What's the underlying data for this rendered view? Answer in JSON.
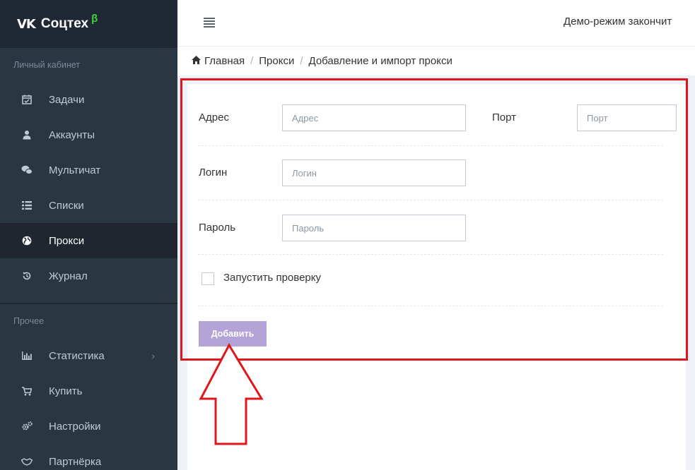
{
  "brand": {
    "logo": "vk-logo",
    "logo_text": "VK",
    "name": "Соцтех",
    "beta": "β"
  },
  "sidebar": {
    "section1_title": "Личный кабинет",
    "items": [
      {
        "label": "Задачи",
        "icon": "calendar-check-icon",
        "glyph": "📅"
      },
      {
        "label": "Аккаунты",
        "icon": "user-icon",
        "glyph": "👤"
      },
      {
        "label": "Мультичат",
        "icon": "chat-icon",
        "glyph": "💬"
      },
      {
        "label": "Списки",
        "icon": "list-icon",
        "glyph": "☰"
      },
      {
        "label": "Прокси",
        "icon": "globe-icon",
        "glyph": "🌍",
        "active": true
      },
      {
        "label": "Журнал",
        "icon": "history-icon",
        "glyph": "↺"
      }
    ],
    "section2_title": "Прочее",
    "items2": [
      {
        "label": "Статистика",
        "icon": "bar-chart-icon",
        "glyph": "📊",
        "chevron": "›"
      },
      {
        "label": "Купить",
        "icon": "cart-icon",
        "glyph": "🛒"
      },
      {
        "label": "Настройки",
        "icon": "cogs-icon",
        "glyph": "⚙"
      },
      {
        "label": "Партнёрка",
        "icon": "handshake-icon",
        "glyph": "🤝"
      }
    ]
  },
  "topbar": {
    "demo_text": "Демо-режим закончит"
  },
  "breadcrumb": {
    "home": "Главная",
    "proxies": "Прокси",
    "current": "Добавление и импорт прокси"
  },
  "form": {
    "address_label": "Адрес",
    "address_placeholder": "Адрес",
    "port_label": "Порт",
    "port_placeholder": "Порт",
    "login_label": "Логин",
    "login_placeholder": "Логин",
    "password_label": "Пароль",
    "password_placeholder": "Пароль",
    "check_label": "Запустить проверку",
    "add_button": "Добавить"
  },
  "colors": {
    "sidebar_bg": "#2b3643",
    "brand_bg": "#1f2833",
    "active_item_bg": "#1f2630",
    "beta": "#3ed33e",
    "button": "#b3a3d6",
    "highlight": "#e0161c"
  }
}
